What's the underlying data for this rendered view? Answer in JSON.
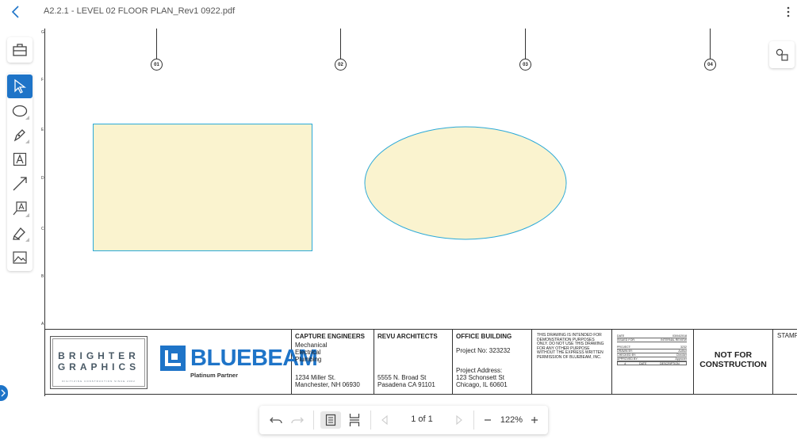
{
  "header": {
    "title": "A2.2.1 - LEVEL 02 FLOOR PLAN_Rev1 0922.pdf"
  },
  "grid": {
    "columns": [
      "01",
      "02",
      "03",
      "04"
    ],
    "rows": [
      "G",
      "F",
      "E",
      "D",
      "C",
      "B",
      "A"
    ]
  },
  "title_block": {
    "logo_primary_line1": "BRIGHTER",
    "logo_primary_line2": "GRAPHICS",
    "logo_primary_tagline": "DIGITIZING CONSTRUCTION SINCE 2002",
    "logo_secondary": "BLUEBEAM",
    "logo_secondary_sub": "Platinum Partner",
    "engineer": {
      "name": "CAPTURE ENGINEERS",
      "services": [
        "Mechanical",
        "Electrical",
        "Plumbing"
      ],
      "address1": "1234 Miller St.",
      "address2": "Manchester, NH 06930"
    },
    "architect": {
      "name": "REVU ARCHITECTS",
      "address1": "5555 N. Broad St",
      "address2": "Pasadena CA 91101"
    },
    "project": {
      "name": "OFFICE BUILDING",
      "number": "Project No: 323232",
      "address_label": "Project Address:",
      "address1": "123 Schonsett St",
      "address2": "Chicago, IL 60601"
    },
    "disclaimer": "THIS DRAWING IS INTENDED FOR DEMONSTRATION PURPOSES ONLY.  DO NOT USE THIS DRAWING FOR ANY OTHER PURPOSE WITHOUT THE EXPRESS WRITTEN PERMISSION OF BLUEBEAM, INC.",
    "info": [
      {
        "label": "DATE",
        "value": "03/04/2018"
      },
      {
        "label": "ISSUED FOR:",
        "value": "INTERNAL REVIEW"
      },
      {
        "label": "PROJECT:",
        "value": "3232"
      },
      {
        "label": "DRAWN BY:",
        "value": "Author"
      },
      {
        "label": "CHECKED BY:",
        "value": "Checker"
      },
      {
        "label": "APPROVED BY:",
        "value": "Approver"
      }
    ],
    "rev_headers": [
      "#",
      "DATE",
      "DESCRIPTION"
    ],
    "status_line1": "NOT FOR",
    "status_line2": "CONSTRUCTION",
    "stamp_label": "STAMP"
  },
  "bottom_toolbar": {
    "page_info": "1 of 1",
    "zoom": "122%"
  },
  "colors": {
    "accent": "#1e74c8",
    "shape_fill": "#faf3cf",
    "shape_stroke": "#2aa9d8"
  },
  "icons": {
    "back": "chevron-left-icon",
    "more": "kebab-icon",
    "tool_chest": "toolbox-icon",
    "select": "cursor-arrow-icon",
    "ellipse": "ellipse-icon",
    "pen": "pen-icon",
    "text": "text-box-icon",
    "arrow": "arrow-icon",
    "callout": "callout-icon",
    "highlight": "highlighter-icon",
    "image": "image-icon",
    "shapes": "shapes-icon",
    "undo": "undo-icon",
    "redo": "redo-icon"
  }
}
